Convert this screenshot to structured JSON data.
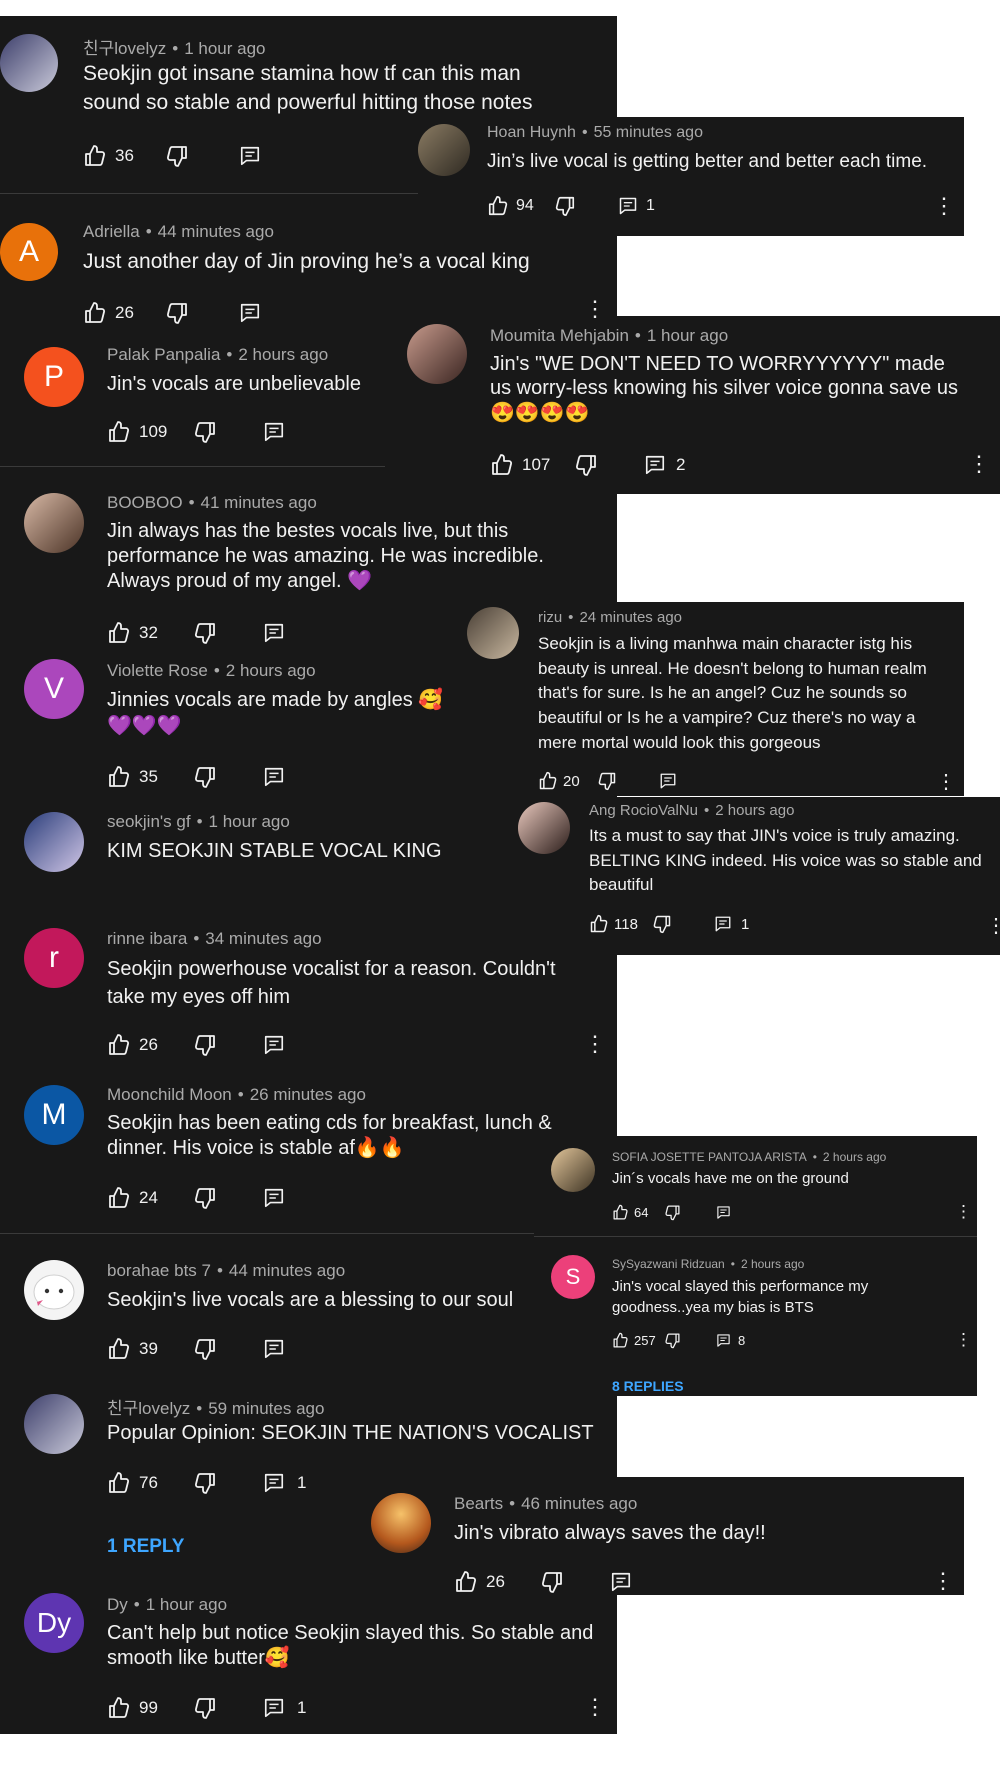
{
  "comments": [
    {
      "author": "친구lovelyz",
      "time": "1 hour ago",
      "text": "Seokjin got insane stamina how tf can this man sound so stable and powerful hitting those notes",
      "likes": "36",
      "replies": ""
    },
    {
      "author": "Hoan Huynh",
      "time": "55 minutes ago",
      "text": "Jin’s live vocal is getting better and better each time.",
      "likes": "94",
      "replies": "1"
    },
    {
      "author": "Adriella",
      "time": "44 minutes ago",
      "text": "Just another day of Jin proving he’s a vocal king",
      "likes": "26",
      "replies": "",
      "initial": "A"
    },
    {
      "author": "Palak Panpalia",
      "time": "2 hours ago",
      "text": "Jin's vocals are unbelievable",
      "likes": "109",
      "replies": "",
      "initial": "P"
    },
    {
      "author": "Moumita Mehjabin",
      "time": "1 hour ago",
      "text": "Jin's \"WE DON'T NEED TO WORRYYYYYY\" made us worry-less knowing his silver voice gonna save us 😍😍😍😍",
      "likes": "107",
      "replies": "2"
    },
    {
      "author": "BOOBOO",
      "time": "41 minutes ago",
      "text": "Jin always has the bestes vocals live, but this performance he was amazing. He was incredible. Always proud of my angel. 💜",
      "likes": "32",
      "replies": ""
    },
    {
      "author": "rizu",
      "time": "24 minutes ago",
      "text": "Seokjin is a living manhwa main character istg his beauty is unreal. He doesn't belong to human realm that's for sure. Is he an angel? Cuz he sounds so beautiful or Is he a vampire? Cuz there's no way a mere mortal would look this gorgeous",
      "likes": "20",
      "replies": ""
    },
    {
      "author": "Violette Rose",
      "time": "2 hours ago",
      "text": "Jinnies vocals are made by angles 🥰 💜💜💜",
      "likes": "35",
      "replies": "",
      "initial": "V"
    },
    {
      "author": "Ang RocioValNu",
      "time": "2 hours ago",
      "text": "Its a must to say that JIN's voice is truly amazing. BELTING KING indeed. His voice was so stable and beautiful",
      "likes": "118",
      "replies": "1"
    },
    {
      "author": "seokjin's gf",
      "time": "1 hour ago",
      "text": "KIM SEOKJIN STABLE VOCAL KING",
      "likes": "",
      "replies": ""
    },
    {
      "author": "rinne ibara",
      "time": "34 minutes ago",
      "text": "Seokjin powerhouse vocalist for a reason. Couldn't take my eyes off him",
      "likes": "26",
      "replies": "",
      "initial": "r"
    },
    {
      "author": "Moonchild Moon",
      "time": "26 minutes ago",
      "text": "Seokjin has been eating cds for breakfast, lunch & dinner. His voice is stable af🔥🔥",
      "likes": "24",
      "replies": "",
      "initial": "M"
    },
    {
      "author": "SOFIA JOSETTE PANTOJA ARISTA",
      "time": "2 hours ago",
      "text": "Jin´s vocals have me on the ground",
      "likes": "64",
      "replies": ""
    },
    {
      "author": "SySyazwani Ridzuan",
      "time": "2 hours ago",
      "text": "Jin's vocal slayed this performance my goodness..yea my bias is BTS",
      "likes": "257",
      "replies": "8",
      "initial": "S",
      "replies_link": "8 REPLIES"
    },
    {
      "author": "borahae bts 7",
      "time": "44 minutes ago",
      "text": "Seokjin's live vocals are a blessing to our soul",
      "likes": "39",
      "replies": ""
    },
    {
      "author": "친구lovelyz",
      "time": "59 minutes ago",
      "text": "Popular Opinion: SEOKJIN THE NATION'S VOCALIST",
      "likes": "76",
      "replies": "1",
      "replies_link": "1 REPLY"
    },
    {
      "author": "Bearts",
      "time": "46 minutes ago",
      "text": "Jin's vibrato always saves the day!!",
      "likes": "26",
      "replies": ""
    },
    {
      "author": "Dy",
      "time": "1 hour ago",
      "text": "Can't help but notice Seokjin slayed this. So stable and smooth like butter🥰",
      "likes": "99",
      "replies": "1",
      "initial": "Dy"
    }
  ],
  "colors": {
    "panel": "#181818",
    "text": "#f1f1f1",
    "meta": "#aaaaaa",
    "link": "#3ea6ff",
    "adriella": "#e8710a",
    "palak": "#f4511e",
    "violette": "#ab47bc",
    "rinne": "#c2185b",
    "moonchild": "#0b57a4",
    "sysyazwani": "#ec407a",
    "dy": "#5e35b1"
  },
  "icons": {
    "like": "thumbs-up-icon",
    "dislike": "thumbs-down-icon",
    "reply": "reply-icon",
    "more": "more-vert-icon"
  }
}
